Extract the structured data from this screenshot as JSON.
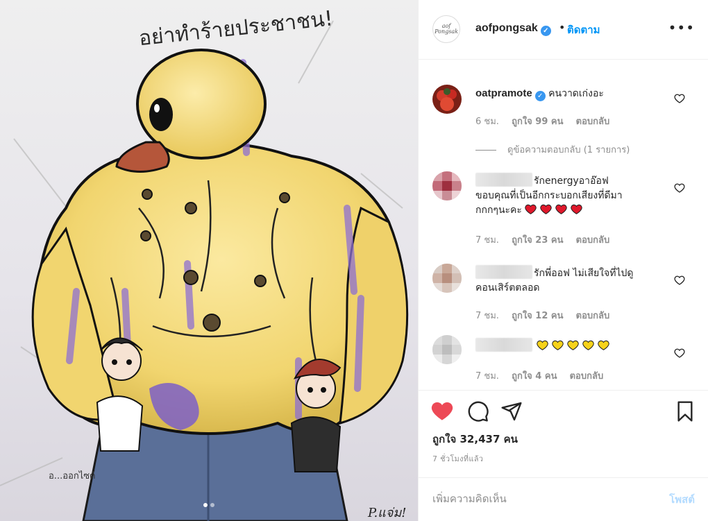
{
  "post": {
    "artwork_caption": "อย่าทำร้ายประชาชน!",
    "artist_note": "อ...ออกไซด์",
    "artist_signature": "P.แจ่ม!",
    "carousel_dots": 2,
    "carousel_active": 0
  },
  "header": {
    "username": "aofpongsak",
    "verified": true,
    "separator": "•",
    "follow_label": "ติดตาม",
    "more_label": "•••",
    "avatar_text": "aof Pongsak"
  },
  "comments": [
    {
      "username": "oatpramote",
      "verified": true,
      "text": "คนวาดเก่งอะ",
      "time": "6 ชม.",
      "likes": "ถูกใจ 99 คน",
      "reply_label": "ตอบกลับ",
      "avatar_icon": "profile-photo-red-flowers"
    },
    {
      "username_hidden": true,
      "text_line1": "รักenergyอาอ๊อฟ",
      "text_line2": "ขอบคุณที่เป็นอีกกระบอกเสียงที่ดีมา",
      "text_line3": "กกกๆนะคะ",
      "emoji": "red-heart",
      "emoji_count": 4,
      "time": "7 ชม.",
      "likes": "ถูกใจ 23 คน",
      "reply_label": "ตอบกลับ",
      "avatar_icon": "pixelated-avatar-red"
    },
    {
      "username_hidden": true,
      "text_line1": "รักพี่ออฟ ไม่เสียใจที่ไปดู",
      "text_line2": "คอนเสิร์ตตลอด",
      "time": "7 ชม.",
      "likes": "ถูกใจ 12 คน",
      "reply_label": "ตอบกลับ",
      "avatar_icon": "pixelated-avatar-skin"
    },
    {
      "username_hidden": true,
      "emoji": "yellow-heart",
      "emoji_count": 5,
      "time": "7 ชม.",
      "likes": "ถูกใจ 4 คน",
      "reply_label": "ตอบกลับ",
      "avatar_icon": "pixelated-avatar-gray"
    }
  ],
  "view_replies": "ดูข้อความตอบกลับ (1 รายการ)",
  "actions": {
    "liked": true,
    "likes_text": "ถูกใจ 32,437 คน",
    "time_ago": "7 ชั่วโมงที่แล้ว",
    "heart_color": "#ed4956"
  },
  "add_comment": {
    "placeholder": "เพิ่มความคิดเห็น",
    "post_label": "โพสต์"
  },
  "colors": {
    "accent": "#0095f6",
    "muted": "#8e8e8e",
    "duck_yellow": "#f4dc7a",
    "paint_purple": "#8d6fd1"
  }
}
